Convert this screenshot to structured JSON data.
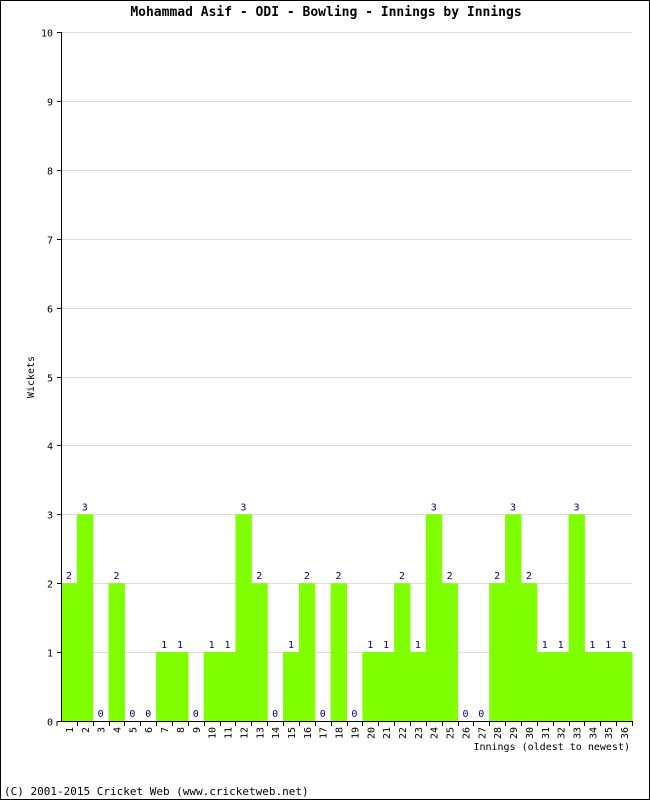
{
  "footer": "(C) 2001-2015 Cricket Web (www.cricketweb.net)",
  "colors": {
    "bar": "#80ff00",
    "grid": "#dcdcdc",
    "label": "#000080"
  },
  "chart_data": {
    "type": "bar",
    "title": "Mohammad Asif - ODI - Bowling - Innings by Innings",
    "xlabel": "Innings (oldest to newest)",
    "ylabel": "Wickets",
    "ylim": [
      0,
      10
    ],
    "yticks": [
      0,
      1,
      2,
      3,
      4,
      5,
      6,
      7,
      8,
      9,
      10
    ],
    "grid": true,
    "categories": [
      "1",
      "2",
      "3",
      "4",
      "5",
      "6",
      "7",
      "8",
      "9",
      "10",
      "11",
      "12",
      "13",
      "14",
      "15",
      "16",
      "17",
      "18",
      "19",
      "20",
      "21",
      "22",
      "23",
      "24",
      "25",
      "26",
      "27",
      "28",
      "29",
      "30",
      "31",
      "32",
      "33",
      "34",
      "35",
      "36"
    ],
    "values": [
      2,
      3,
      0,
      2,
      0,
      0,
      1,
      1,
      0,
      1,
      1,
      3,
      2,
      0,
      1,
      2,
      0,
      2,
      0,
      1,
      1,
      2,
      1,
      3,
      2,
      0,
      0,
      2,
      3,
      2,
      1,
      1,
      3,
      1,
      1,
      1
    ]
  }
}
